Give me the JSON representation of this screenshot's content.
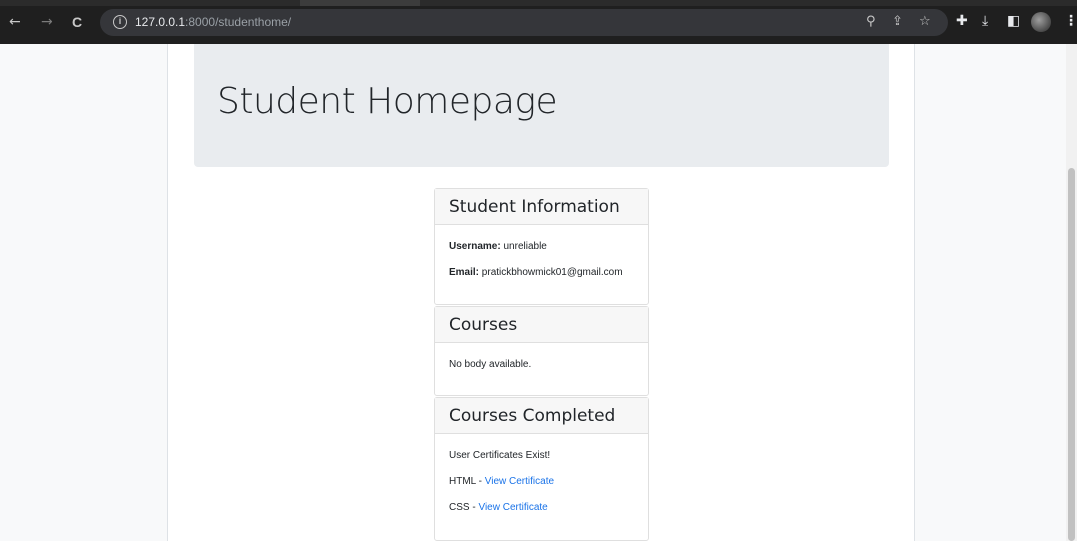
{
  "browser": {
    "back_icon": "←",
    "forward_icon": "→",
    "reload_icon": "C",
    "url_host": "127.0.0.1",
    "url_path": ":8000/studenthome/"
  },
  "page": {
    "title": "Student Homepage"
  },
  "student_info": {
    "header": "Student Information",
    "username_label": "Username:",
    "username_value": "unreliable",
    "email_label": "Email:",
    "email_value": "pratickbhowmick01@gmail.com"
  },
  "courses": {
    "header": "Courses",
    "empty_text": "No body available."
  },
  "courses_completed": {
    "header": "Courses Completed",
    "status_text": "User Certificates Exist!",
    "items": [
      {
        "course": "HTML",
        "separator": " - ",
        "link": "View Certificate"
      },
      {
        "course": "CSS",
        "separator": " - ",
        "link": "View Certificate"
      }
    ]
  },
  "colors": {
    "link": "#1a73e8",
    "jumbotron_bg": "#e9ecef",
    "chrome_bg": "#1f1f1f"
  }
}
